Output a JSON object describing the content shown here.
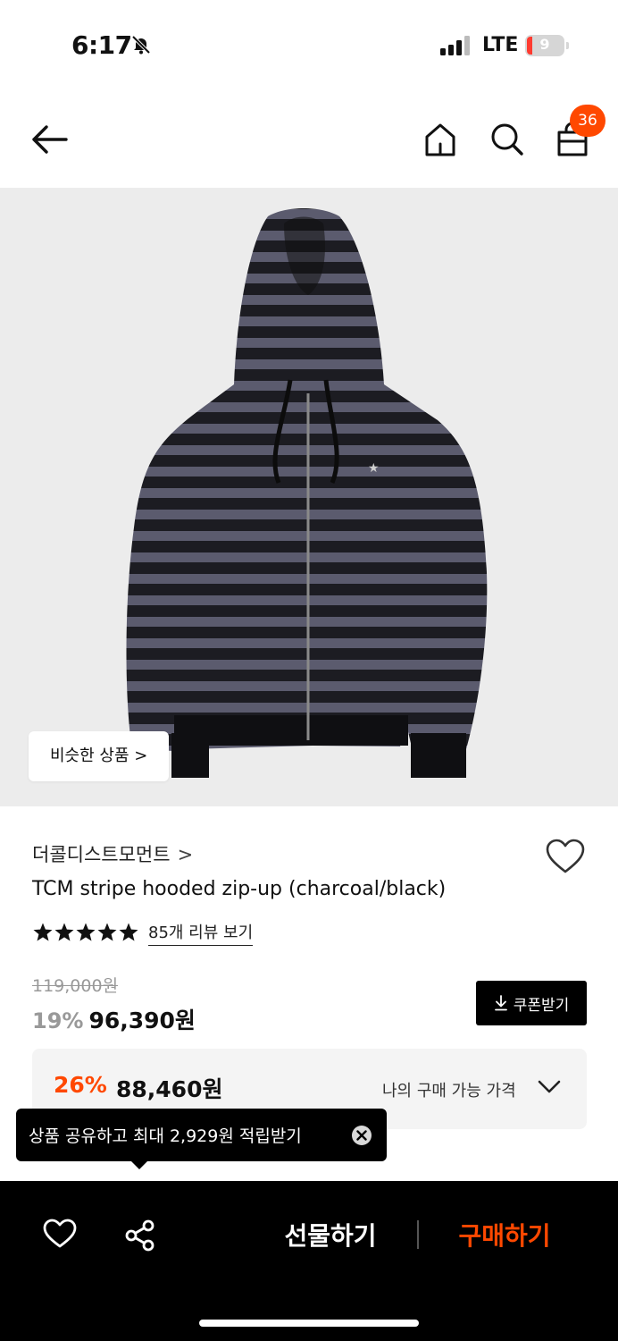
{
  "status": {
    "time": "6:17",
    "network": "LTE",
    "battery": "9"
  },
  "nav": {
    "cart_count": "36"
  },
  "product": {
    "similar_button": "비슷한 상품 >",
    "brand": "더콜디스트모먼트",
    "brand_chevron": ">",
    "title": "TCM stripe hooded zip-up (charcoal/black)",
    "rating_stars": 5,
    "review_link": "85개 리뷰 보기",
    "original_price": "119,000원",
    "discount": "19%",
    "sale_price": "96,390원",
    "coupon_button": "쿠폰받기",
    "my_discount": "26%",
    "my_price": "88,460원",
    "my_price_label": "나의 구매 가능 가격"
  },
  "tooltip": {
    "text": "상품 공유하고 최대 2,929원 적립받기"
  },
  "bottom_bar": {
    "gift_label": "선물하기",
    "buy_label": "구매하기"
  },
  "colors": {
    "accent": "#ff4800",
    "price_box_bg": "#f4f4f4",
    "hero_bg": "#ececec"
  }
}
